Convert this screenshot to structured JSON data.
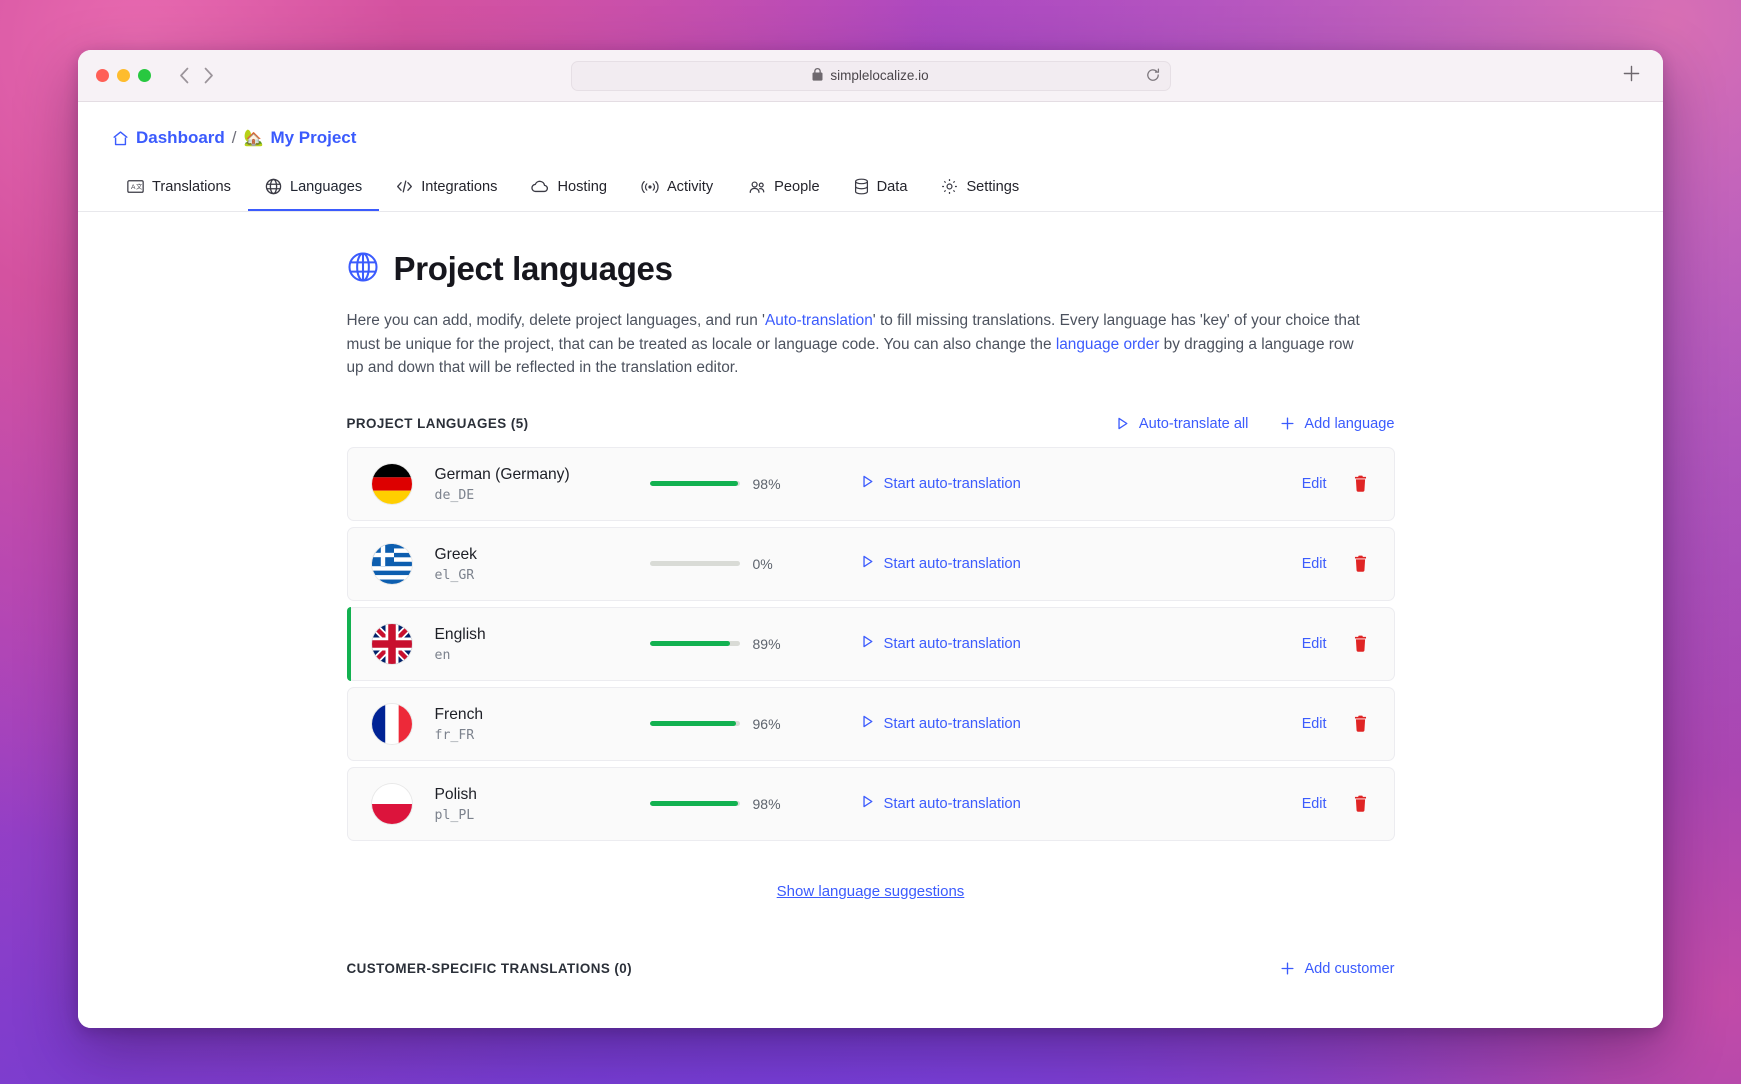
{
  "browser": {
    "url": "simplelocalize.io",
    "lock_icon": "lock-icon",
    "reload_icon": "reload-icon",
    "new_tab_icon": "plus-icon",
    "back_icon": "chevron-left-icon",
    "forward_icon": "chevron-right-icon"
  },
  "breadcrumb": {
    "home_icon": "home-icon",
    "dashboard": "Dashboard",
    "separator": "/",
    "project_emoji": "🏡",
    "project": "My Project"
  },
  "tabs": [
    {
      "label": "Translations",
      "icon": "translate-icon",
      "active": false
    },
    {
      "label": "Languages",
      "icon": "globe-icon",
      "active": true
    },
    {
      "label": "Integrations",
      "icon": "code-icon",
      "active": false
    },
    {
      "label": "Hosting",
      "icon": "cloud-icon",
      "active": false
    },
    {
      "label": "Activity",
      "icon": "broadcast-icon",
      "active": false
    },
    {
      "label": "People",
      "icon": "people-icon",
      "active": false
    },
    {
      "label": "Data",
      "icon": "database-icon",
      "active": false
    },
    {
      "label": "Settings",
      "icon": "gear-icon",
      "active": false
    }
  ],
  "page": {
    "title": "Project languages",
    "title_icon": "globe-icon",
    "desc_part1": "Here you can add, modify, delete project languages, and run '",
    "desc_link1": "Auto-translation",
    "desc_part2": "' to fill missing translations. Every language has 'key' of your choice that must be unique for the project, that can be treated as locale or language code. You can also change the ",
    "desc_link2": "language order",
    "desc_part3": " by dragging a language row up and down that will be reflected in the translation editor."
  },
  "languages_section": {
    "label": "PROJECT LANGUAGES (5)",
    "auto_translate_all": "Auto-translate all",
    "auto_translate_all_icon": "play-icon",
    "add_language": "Add language",
    "add_language_icon": "plus-icon"
  },
  "languages": [
    {
      "name": "German (Germany)",
      "key": "de_DE",
      "progress": 98,
      "progress_label": "98%",
      "flag": "germany-flag",
      "start_label": "Start auto-translation",
      "start_icon": "play-icon",
      "edit_label": "Edit",
      "delete_icon": "trash-icon",
      "selected": false
    },
    {
      "name": "Greek",
      "key": "el_GR",
      "progress": 0,
      "progress_label": "0%",
      "flag": "greece-flag",
      "start_label": "Start auto-translation",
      "start_icon": "play-icon",
      "edit_label": "Edit",
      "delete_icon": "trash-icon",
      "selected": false
    },
    {
      "name": "English",
      "key": "en",
      "progress": 89,
      "progress_label": "89%",
      "flag": "uk-flag",
      "start_label": "Start auto-translation",
      "start_icon": "play-icon",
      "edit_label": "Edit",
      "delete_icon": "trash-icon",
      "selected": true
    },
    {
      "name": "French",
      "key": "fr_FR",
      "progress": 96,
      "progress_label": "96%",
      "flag": "france-flag",
      "start_label": "Start auto-translation",
      "start_icon": "play-icon",
      "edit_label": "Edit",
      "delete_icon": "trash-icon",
      "selected": false
    },
    {
      "name": "Polish",
      "key": "pl_PL",
      "progress": 98,
      "progress_label": "98%",
      "flag": "poland-flag",
      "start_label": "Start auto-translation",
      "start_icon": "play-icon",
      "edit_label": "Edit",
      "delete_icon": "trash-icon",
      "selected": false
    }
  ],
  "suggestions_link": "Show language suggestions",
  "customer_section": {
    "label": "CUSTOMER-SPECIFIC TRANSLATIONS (0)",
    "add_customer": "Add customer",
    "add_customer_icon": "plus-icon"
  },
  "colors": {
    "accent_blue": "#3b5bfd",
    "progress_green": "#12b150",
    "progress_track": "#d9dbd6",
    "delete_red": "#e02424",
    "text_dark": "#16161d",
    "text_muted": "#7c828d"
  }
}
